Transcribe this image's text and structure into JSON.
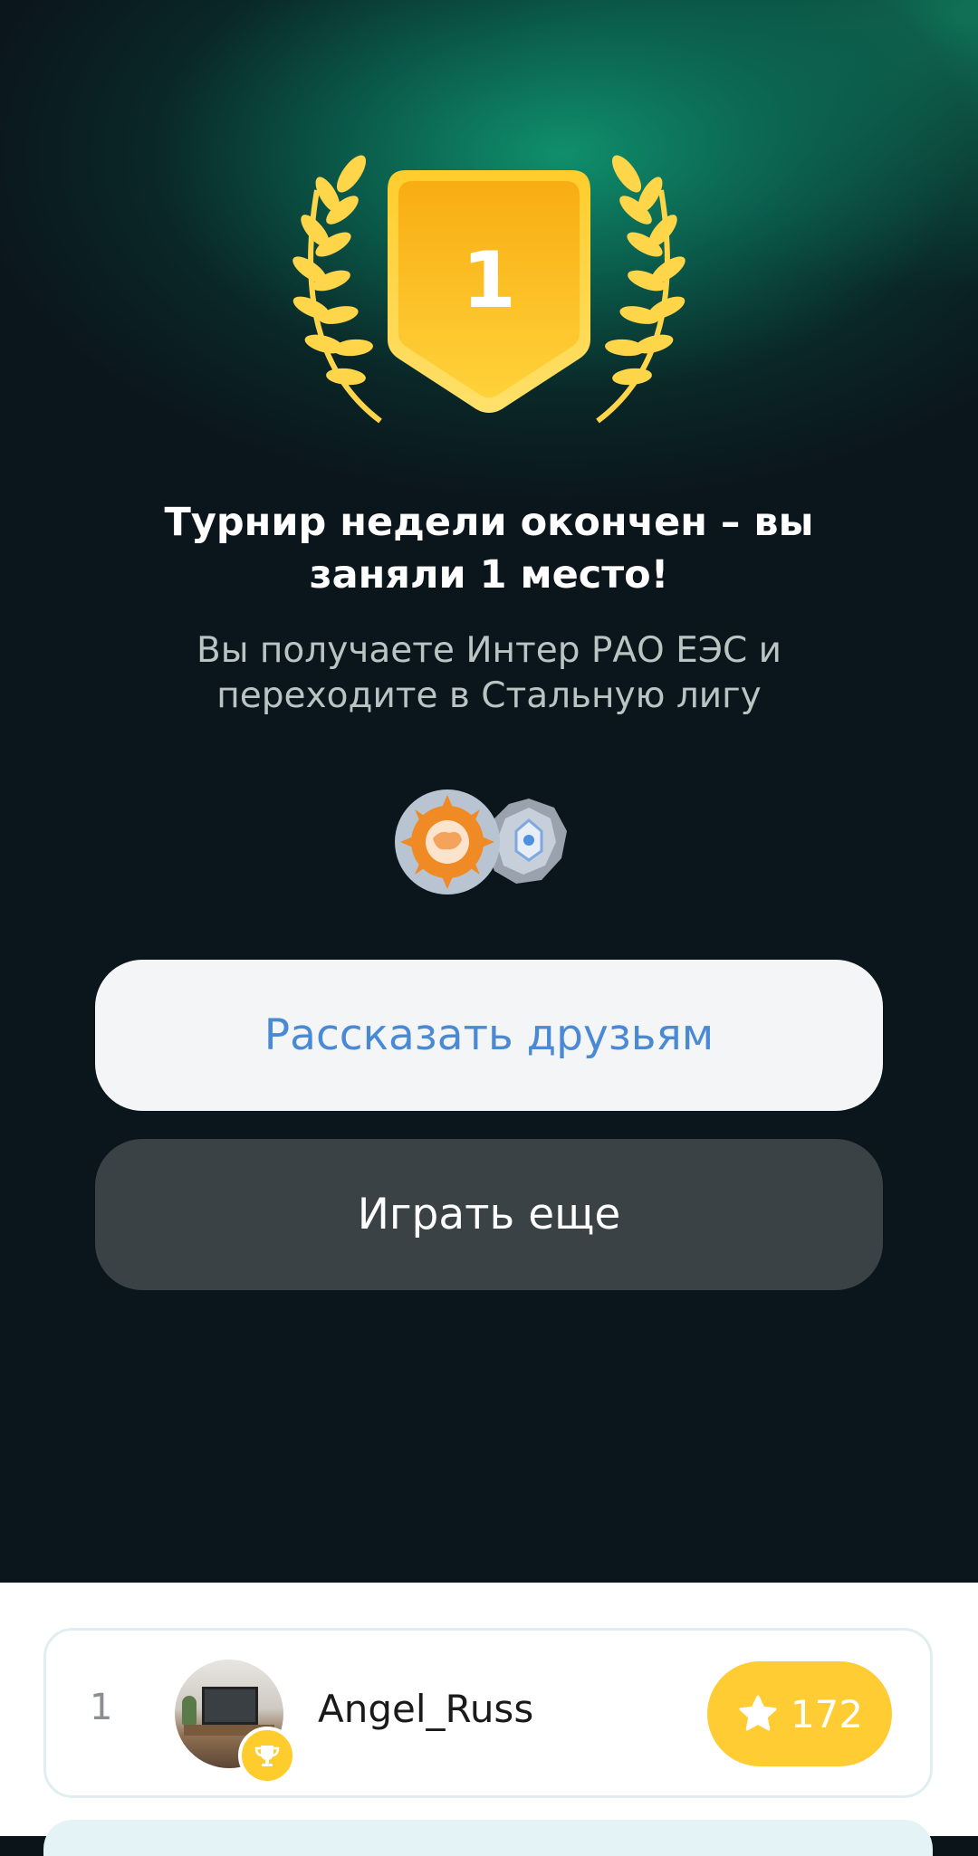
{
  "result": {
    "place_number": "1",
    "title": "Турнир недели окончен – вы заняли 1 место!",
    "subtitle": "Вы получаете Интер РАО ЕЭС и переходите в Стальную лигу"
  },
  "actions": {
    "share_label": "Рассказать друзьям",
    "play_again_label": "Играть еще"
  },
  "leaderboard": {
    "rows": [
      {
        "rank": "1",
        "username": "Angel_Russ",
        "score": "172"
      }
    ]
  },
  "colors": {
    "accent_gold": "#ffcc33",
    "share_text": "#4a8ad4",
    "hero_green": "#109670"
  },
  "icons": [
    "laurel-icon",
    "medal-icon",
    "company-logo-icon",
    "league-badge-icon",
    "trophy-icon",
    "star-icon"
  ]
}
